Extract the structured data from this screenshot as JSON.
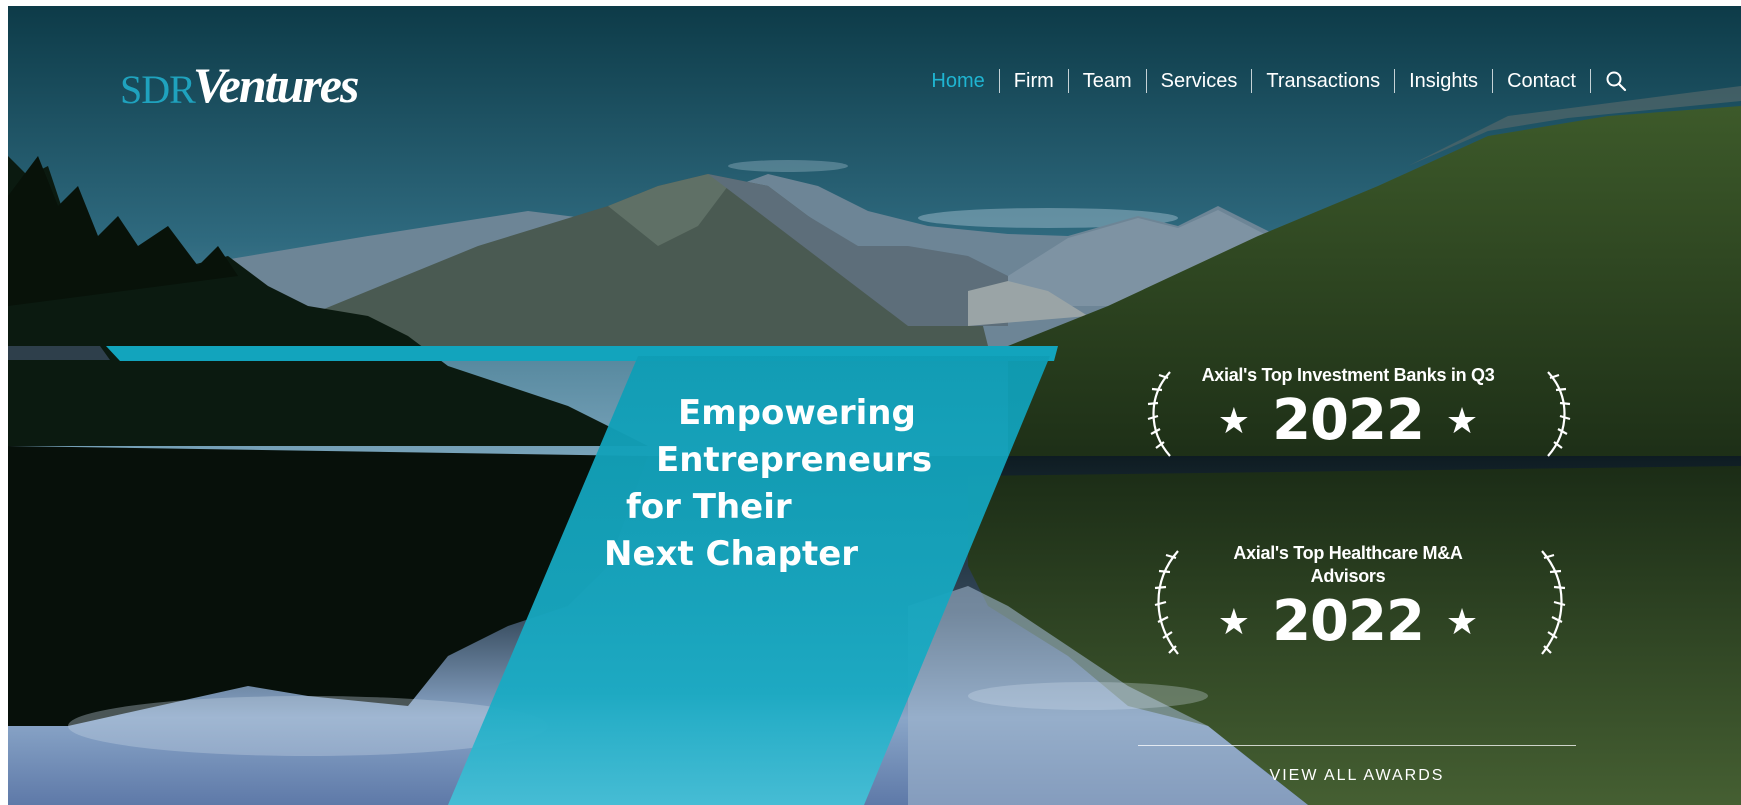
{
  "brand": {
    "logo_prefix": "SDR",
    "logo_main": "Ventures"
  },
  "nav": {
    "items": [
      {
        "label": "Home",
        "active": true
      },
      {
        "label": "Firm"
      },
      {
        "label": "Team"
      },
      {
        "label": "Services"
      },
      {
        "label": "Transactions"
      },
      {
        "label": "Insights"
      },
      {
        "label": "Contact"
      }
    ],
    "search_icon": "search-icon"
  },
  "hero": {
    "headline_lines": [
      "Empowering",
      "Entrepreneurs",
      "for Their",
      "Next Chapter"
    ]
  },
  "awards": {
    "items": [
      {
        "title_lines": [
          "Axial's Top Investment Banks in Q3"
        ],
        "year": "2022"
      },
      {
        "title_lines": [
          "Axial's Top Healthcare M&A",
          "Advisors"
        ],
        "year": "2022"
      }
    ],
    "star_glyph": "★",
    "view_all_label": "VIEW ALL AWARDS"
  },
  "colors": {
    "accent": "#1fb5d2",
    "panel": "#12a4bd",
    "text": "#ffffff"
  }
}
